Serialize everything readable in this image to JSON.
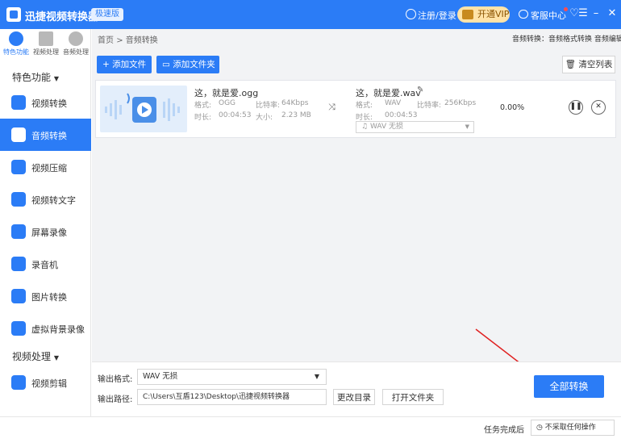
{
  "titlebar": {
    "app_title": "迅捷视频转换器",
    "edition_badge": "极速版",
    "login": "注册/登录",
    "vip": "开通VIP",
    "service": "客服中心",
    "window_buttons": [
      "heart-icon",
      "menu-icon",
      "minimize-icon",
      "close-icon"
    ]
  },
  "sidebar": {
    "tabs": [
      {
        "label": "特色功能",
        "icon": "star-icon",
        "active": true
      },
      {
        "label": "视频处理",
        "icon": "film-icon",
        "active": false
      },
      {
        "label": "音频处理",
        "icon": "disc-icon",
        "active": false
      }
    ],
    "groups": [
      "特色功能",
      "视频处理"
    ],
    "items": [
      {
        "label": "视频转换",
        "icon": "video-convert-icon"
      },
      {
        "label": "音频转换",
        "icon": "audio-convert-icon",
        "active": true
      },
      {
        "label": "视频压缩",
        "icon": "compress-icon"
      },
      {
        "label": "视频转文字",
        "icon": "video-to-text-icon"
      },
      {
        "label": "屏幕录像",
        "icon": "screen-record-icon"
      },
      {
        "label": "录音机",
        "icon": "recorder-icon"
      },
      {
        "label": "图片转换",
        "icon": "image-convert-icon"
      },
      {
        "label": "虚拟背景录像",
        "icon": "virtual-bg-icon"
      },
      {
        "label": "视频剪辑",
        "icon": "video-edit-icon"
      }
    ]
  },
  "breadcrumb": {
    "home": "首页",
    "separator": ">",
    "current": "音频转换"
  },
  "quicklinks": "音频转换：音频格式转换 音频编辑",
  "toolbar": {
    "add_file": "添加文件",
    "add_folder": "添加文件夹",
    "clear_list": "清空列表"
  },
  "file": {
    "source": {
      "name": "这，就是爱.ogg",
      "format_label": "格式:",
      "format": "OGG",
      "bitrate_label": "比特率:",
      "bitrate": "64Kbps",
      "duration_label": "时长:",
      "duration": "00:04:53",
      "size_label": "大小:",
      "size": "2.23 MB"
    },
    "target": {
      "name": "这，就是爱.wav",
      "format_label": "格式:",
      "format": "WAV",
      "bitrate_label": "比特率:",
      "bitrate": "256Kbps",
      "duration_label": "时长:",
      "duration": "00:04:53",
      "preset": "WAV  无损"
    },
    "progress": "0.00%"
  },
  "output": {
    "format_label": "输出格式:",
    "format_value": "WAV  无损",
    "path_label": "输出路径:",
    "path_value": "C:\\Users\\互盾123\\Desktop\\迅捷视频转换器",
    "change_dir": "更改目录",
    "open_folder": "打开文件夹"
  },
  "convert_all": "全部转换",
  "status": {
    "after_label": "任务完成后",
    "after_value": "不采取任何操作"
  },
  "colors": {
    "accent": "#2b7cf6",
    "vip": "#ffe3a8",
    "annotation_arrow": "#e02020"
  }
}
